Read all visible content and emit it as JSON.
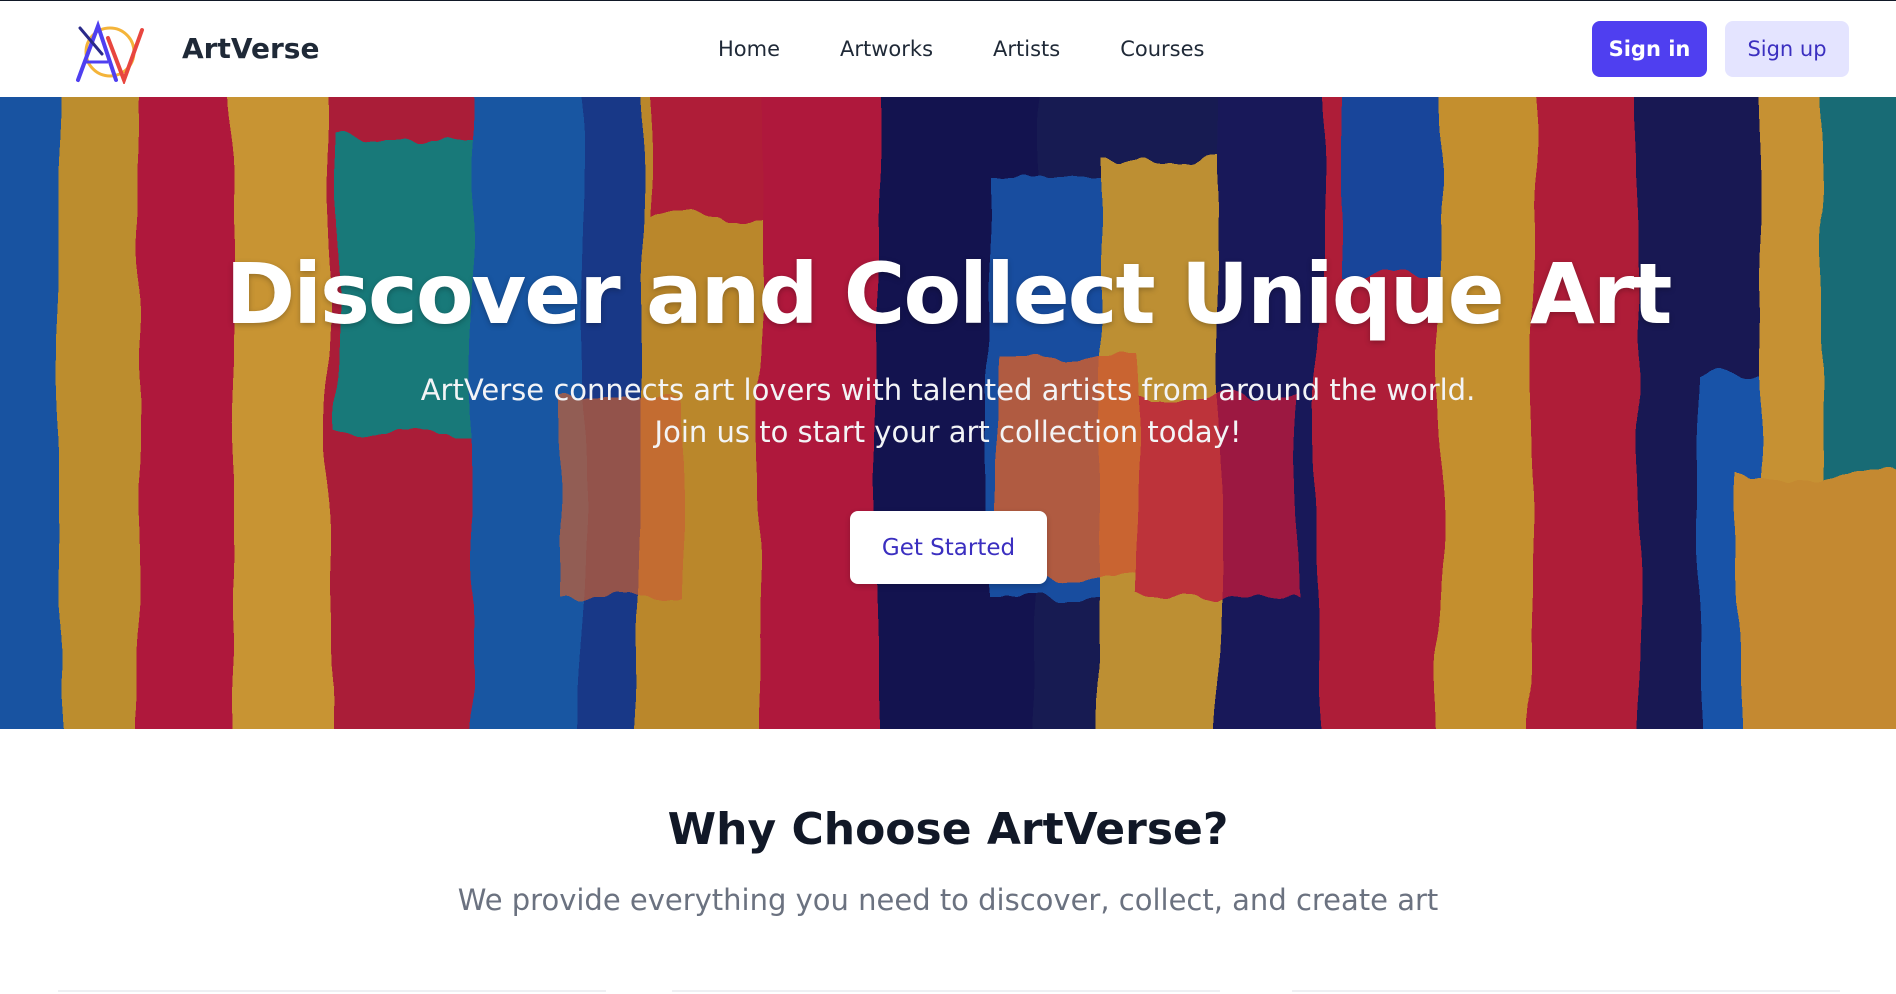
{
  "navbar": {
    "brand": "ArtVerse",
    "links": [
      "Home",
      "Artworks",
      "Artists",
      "Courses"
    ],
    "sign_in": "Sign in",
    "sign_up": "Sign up",
    "logo_icon": "artverse-logo-icon"
  },
  "hero": {
    "title": "Discover and Collect Unique Art",
    "subtitle": "ArtVerse connects art lovers with talented artists from around the world. Join us to start your art collection today!",
    "cta": "Get Started"
  },
  "features": {
    "title": "Why Choose ArtVerse?",
    "subtitle": "We provide everything you need to discover, collect, and create art"
  },
  "colors": {
    "accent": "#4f3ff0",
    "accent_soft": "#e4e4ff",
    "text_dark": "#111827",
    "text_muted": "#6b7280"
  }
}
